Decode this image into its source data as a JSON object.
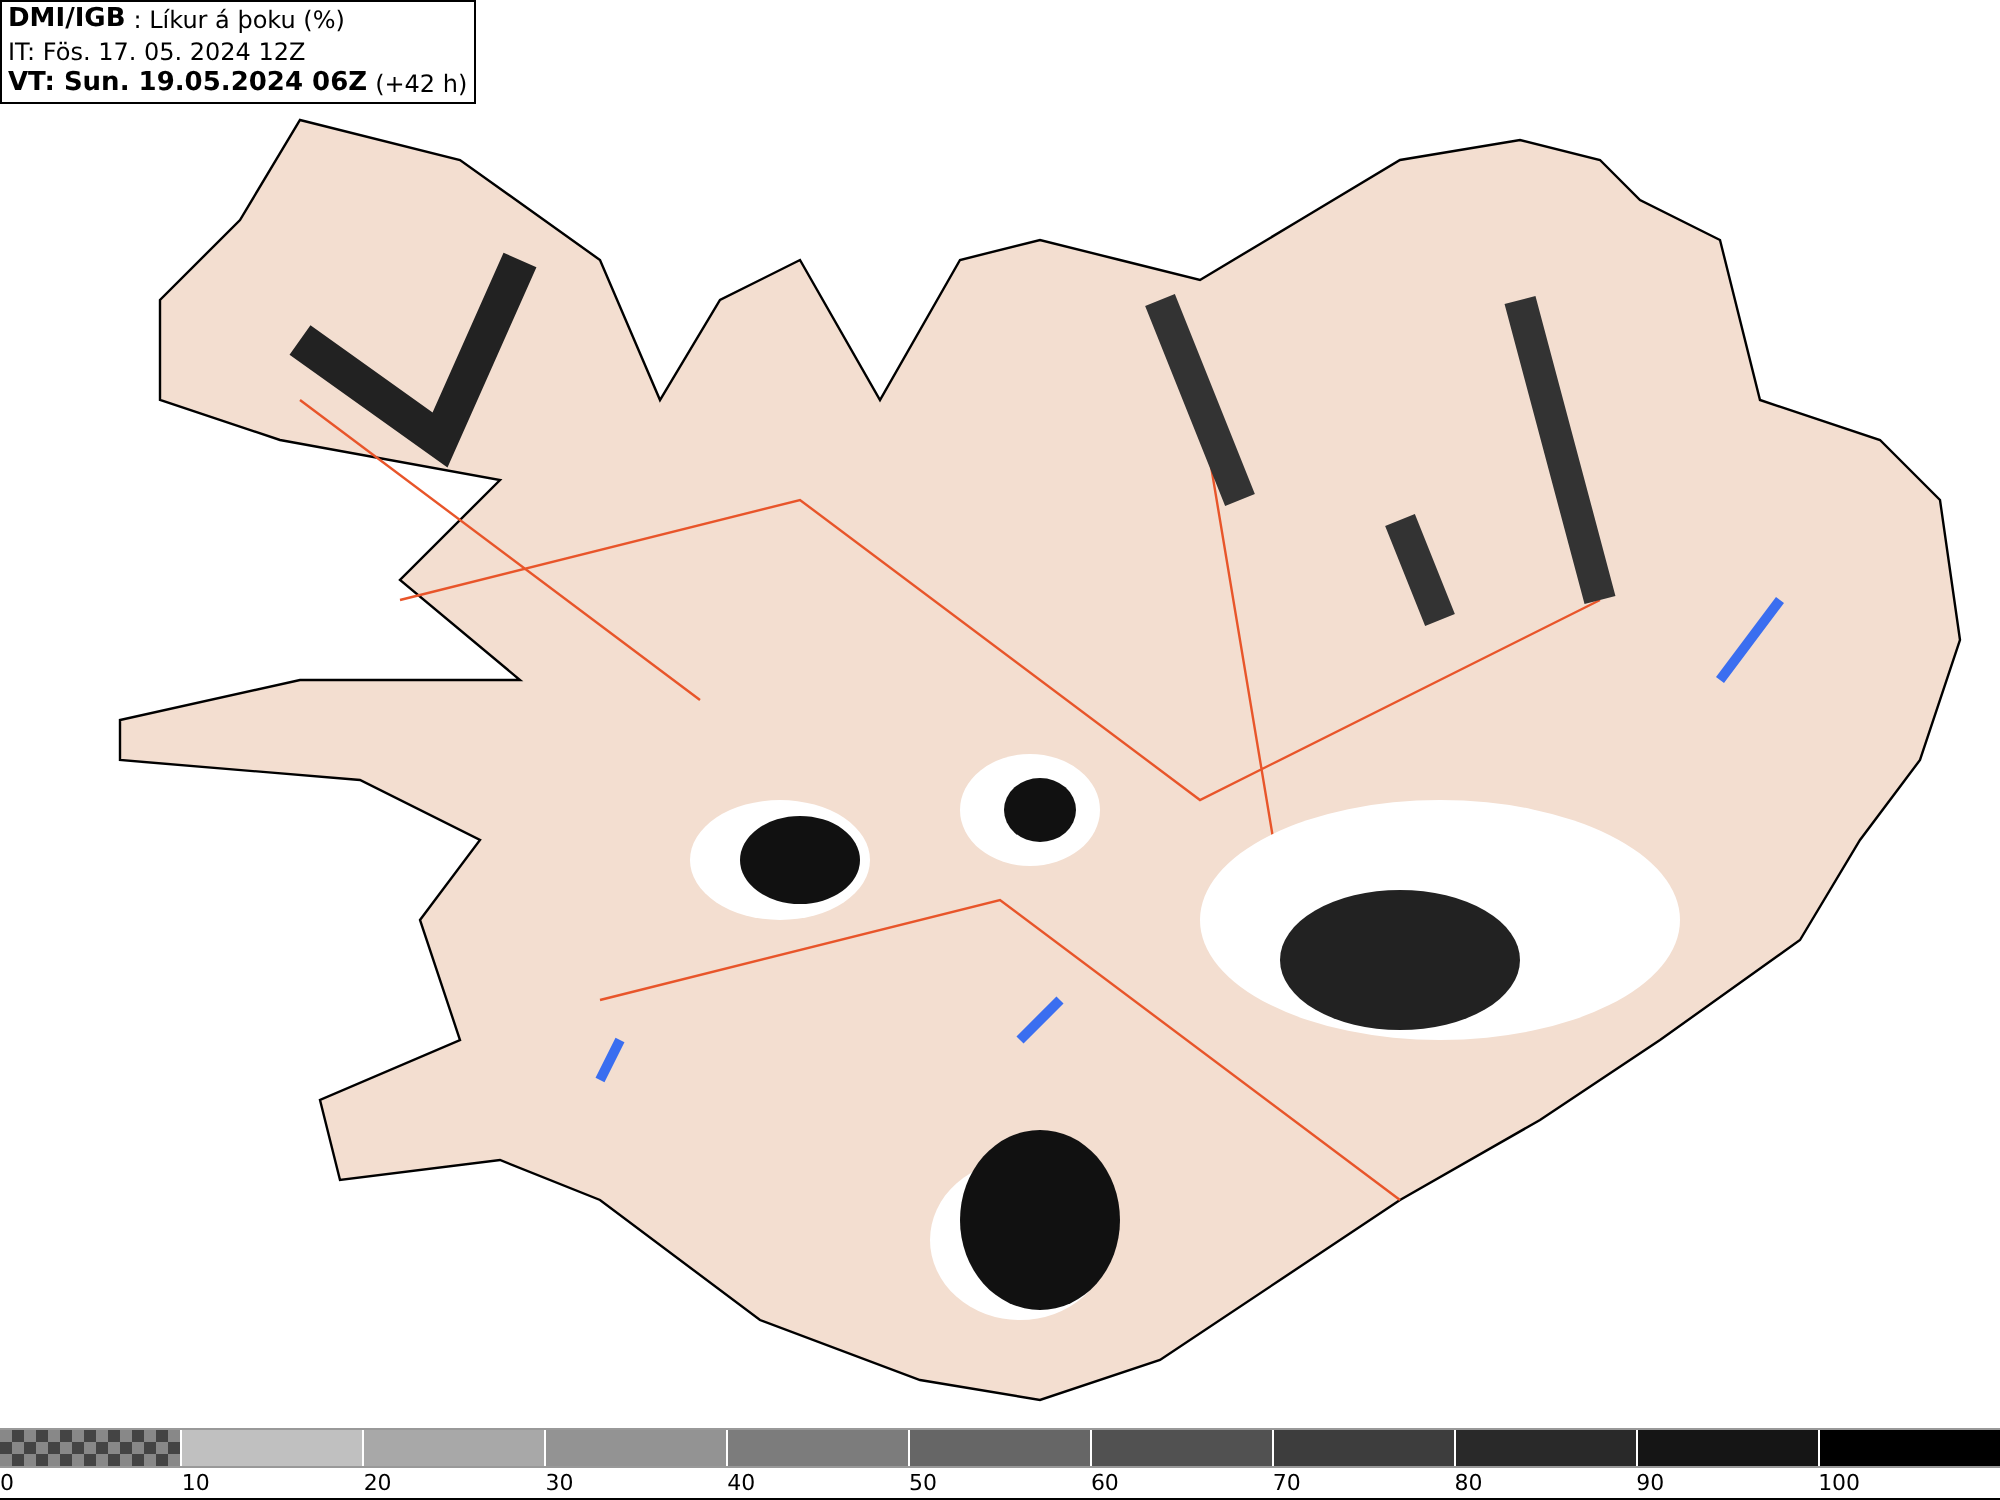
{
  "header": {
    "source": "DMI/IGB",
    "title": ": Líkur á þoku (%)",
    "issued": "IT: Fös. 17. 05. 2024 12Z",
    "valid": "VT: Sun. 19.05.2024 06Z",
    "offset": "(+42 h)"
  },
  "legend": {
    "bins": [
      {
        "label": "0",
        "kind": "checker",
        "color": "#7a7a7a"
      },
      {
        "label": "10",
        "kind": "solid",
        "color": "#c0c0c0"
      },
      {
        "label": "20",
        "kind": "solid",
        "color": "#a8a8a8"
      },
      {
        "label": "30",
        "kind": "solid",
        "color": "#939393"
      },
      {
        "label": "40",
        "kind": "solid",
        "color": "#7c7c7c"
      },
      {
        "label": "50",
        "kind": "solid",
        "color": "#666666"
      },
      {
        "label": "60",
        "kind": "solid",
        "color": "#515151"
      },
      {
        "label": "70",
        "kind": "solid",
        "color": "#3d3d3d"
      },
      {
        "label": "80",
        "kind": "solid",
        "color": "#292929"
      },
      {
        "label": "90",
        "kind": "solid",
        "color": "#151515"
      },
      {
        "label": "100",
        "kind": "solid",
        "color": "#000000"
      }
    ]
  }
}
